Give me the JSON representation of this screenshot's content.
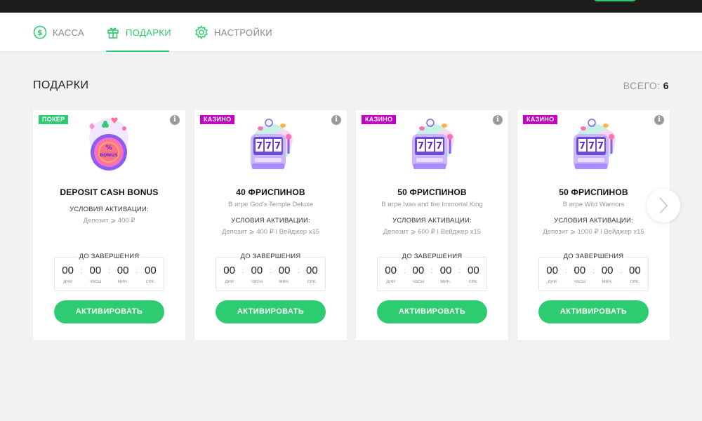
{
  "header": {
    "tabs": [
      {
        "label": "КАССА",
        "icon": "dollar-coin-icon",
        "active": false
      },
      {
        "label": "ПОДАРКИ",
        "icon": "gift-icon",
        "active": true
      },
      {
        "label": "НАСТРОЙКИ",
        "icon": "gear-icon",
        "active": false
      }
    ],
    "accent_color": "#2ecc71"
  },
  "section": {
    "title": "ПОДАРКИ",
    "total_label": "ВСЕГО:",
    "total_count": "6"
  },
  "cards": [
    {
      "badge": "ПОКЕР",
      "badge_color": "#2ecc71",
      "illustration": "bonus-chip-icon",
      "title": "DEPOSIT CASH BONUS",
      "subtitle": "",
      "conditions_label": "УСЛОВИЯ АКТИВАЦИИ:",
      "conditions_value": "Депозит ⩾ 400 ₽",
      "timer_label": "ДО ЗАВЕРШЕНИЯ",
      "timer": [
        {
          "value": "00",
          "unit": "дни"
        },
        {
          "value": "00",
          "unit": "часы"
        },
        {
          "value": "00",
          "unit": "мин."
        },
        {
          "value": "00",
          "unit": "сек."
        }
      ],
      "button": "АКТИВИРОВАТЬ"
    },
    {
      "badge": "КАЗИНО",
      "badge_color": "#c400c4",
      "illustration": "slot-machine-icon",
      "title": "40 ФРИСПИНОВ",
      "subtitle": "В игре God's Temple Deluxe",
      "conditions_label": "УСЛОВИЯ АКТИВАЦИИ:",
      "conditions_value": "Депозит ⩾ 400 ₽ I Вейджер x15",
      "timer_label": "ДО ЗАВЕРШЕНИЯ",
      "timer": [
        {
          "value": "00",
          "unit": "дни"
        },
        {
          "value": "00",
          "unit": "часы"
        },
        {
          "value": "00",
          "unit": "мин."
        },
        {
          "value": "00",
          "unit": "сек."
        }
      ],
      "button": "АКТИВИРОВАТЬ"
    },
    {
      "badge": "КАЗИНО",
      "badge_color": "#c400c4",
      "illustration": "slot-machine-icon",
      "title": "50 ФРИСПИНОВ",
      "subtitle": "В игре Ivan and the Immortal King",
      "conditions_label": "УСЛОВИЯ АКТИВАЦИИ:",
      "conditions_value": "Депозит ⩾ 600 ₽ I Вейджер x15",
      "timer_label": "ДО ЗАВЕРШЕНИЯ",
      "timer": [
        {
          "value": "00",
          "unit": "дни"
        },
        {
          "value": "00",
          "unit": "часы"
        },
        {
          "value": "00",
          "unit": "мин."
        },
        {
          "value": "00",
          "unit": "сек."
        }
      ],
      "button": "АКТИВИРОВАТЬ"
    },
    {
      "badge": "КАЗИНО",
      "badge_color": "#c400c4",
      "illustration": "slot-machine-icon",
      "title": "50 ФРИСПИНОВ",
      "subtitle": "В игре Wild Warriors",
      "conditions_label": "УСЛОВИЯ АКТИВАЦИИ:",
      "conditions_value": "Депозит ⩾ 1000 ₽ I Вейджер x15",
      "timer_label": "ДО ЗАВЕРШЕНИЯ",
      "timer": [
        {
          "value": "00",
          "unit": "дни"
        },
        {
          "value": "00",
          "unit": "часы"
        },
        {
          "value": "00",
          "unit": "мин."
        },
        {
          "value": "00",
          "unit": "сек."
        }
      ],
      "button": "АКТИВИРОВАТЬ"
    }
  ],
  "carousel": {
    "next_icon": "chevron-right-icon"
  }
}
